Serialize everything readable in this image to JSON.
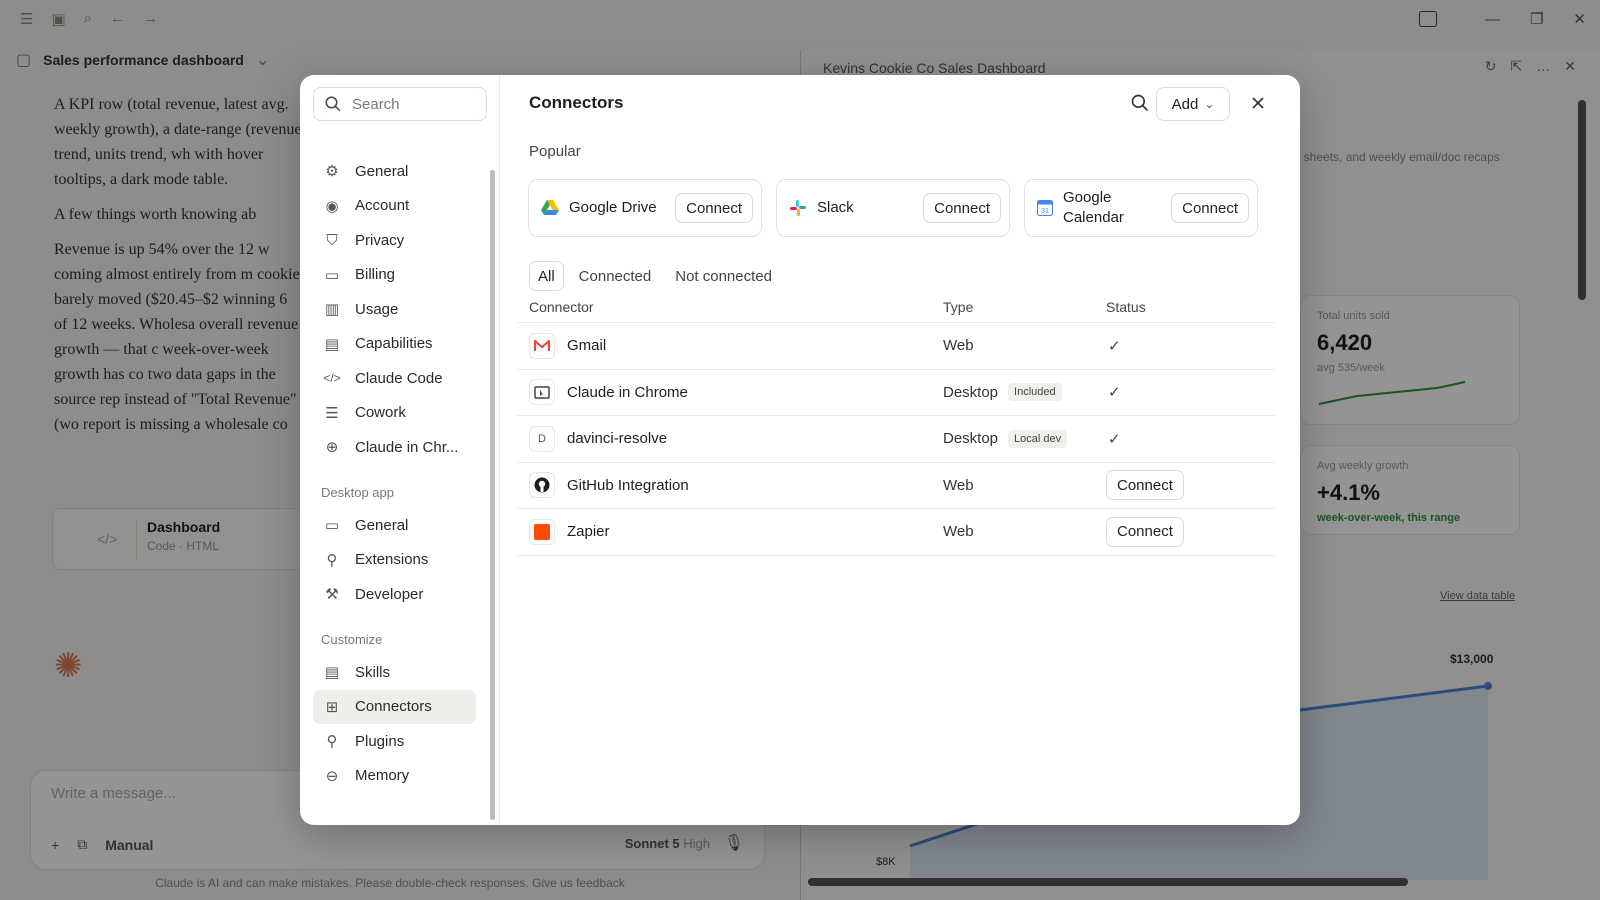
{
  "app": {
    "chat_title": "Sales performance dashboard",
    "chat_paragraphs": [
      "A KPI row (total revenue, latest avg. weekly growth), a date-range (revenue trend, units trend, wh with hover tooltips, a dark mode table.",
      "A few things worth knowing ab",
      "Revenue is up 54% over the 12 w coming almost entirely from m cookie barely moved ($20.45–$2 winning 6 of 12 weeks. Wholesa overall revenue growth — that c week-over-week growth has co two data gaps in the source rep instead of \"Total Revenue\" (wo report is missing a wholesale co"
    ],
    "artifact": {
      "title": "Dashboard",
      "subtitle": "Code · HTML"
    },
    "composer": {
      "placeholder": "Write a message...",
      "mode": "Manual",
      "model": "Sonnet 5",
      "effort": "High"
    },
    "disclaimer": "Claude is AI and can make mistakes. Please double-check responses. Give us feedback",
    "panel_title": "Kevins Cookie Co Sales Dashboard",
    "panel_snippet": "ops sheets, and weekly email/doc recaps",
    "kpis": [
      {
        "label": "Total units sold",
        "value": "6,420",
        "sub": "avg 535/week"
      },
      {
        "label": "Avg weekly growth",
        "value": "+4.1%",
        "sub": "week-over-week, this range"
      }
    ],
    "view_data_link": "View data table",
    "chart_peak": "$13,000",
    "chart_axis": "$8K"
  },
  "modal": {
    "search_placeholder": "Search",
    "nav_groups": [
      {
        "title": "",
        "items": [
          {
            "label": "General",
            "icon": "gear-icon"
          },
          {
            "label": "Account",
            "icon": "user-circle-icon"
          },
          {
            "label": "Privacy",
            "icon": "shield-icon"
          },
          {
            "label": "Billing",
            "icon": "card-icon"
          },
          {
            "label": "Usage",
            "icon": "bar-chart-icon"
          },
          {
            "label": "Capabilities",
            "icon": "briefcase-icon"
          },
          {
            "label": "Claude Code",
            "icon": "code-icon"
          },
          {
            "label": "Cowork",
            "icon": "list-icon"
          },
          {
            "label": "Claude in Chr...",
            "icon": "globe-icon"
          }
        ]
      },
      {
        "title": "Desktop app",
        "items": [
          {
            "label": "General",
            "icon": "monitor-icon"
          },
          {
            "label": "Extensions",
            "icon": "plug-icon"
          },
          {
            "label": "Developer",
            "icon": "wrench-icon"
          }
        ]
      },
      {
        "title": "Customize",
        "items": [
          {
            "label": "Skills",
            "icon": "scroll-icon"
          },
          {
            "label": "Connectors",
            "icon": "grid-plus-icon",
            "active": true
          },
          {
            "label": "Plugins",
            "icon": "plug-icon"
          },
          {
            "label": "Memory",
            "icon": "memory-icon"
          }
        ]
      }
    ],
    "title": "Connectors",
    "add_label": "Add",
    "popular_label": "Popular",
    "popular": [
      {
        "name": "Google Drive",
        "icon": "google-drive-icon",
        "action": "Connect"
      },
      {
        "name": "Slack",
        "icon": "slack-icon",
        "action": "Connect"
      },
      {
        "name": "Google Calendar",
        "icon": "google-calendar-icon",
        "action": "Connect"
      }
    ],
    "filters": [
      "All",
      "Connected",
      "Not connected"
    ],
    "columns": [
      "Connector",
      "Type",
      "Status"
    ],
    "rows": [
      {
        "name": "Gmail",
        "icon": "gmail-icon",
        "type": "Web",
        "badge": "",
        "status": "check"
      },
      {
        "name": "Claude in Chrome",
        "icon": "browser-icon",
        "type": "Desktop",
        "badge": "Included",
        "status": "check"
      },
      {
        "name": "davinci-resolve",
        "icon": "letter-d-icon",
        "type": "Desktop",
        "badge": "Local dev",
        "status": "check"
      },
      {
        "name": "GitHub Integration",
        "icon": "github-icon",
        "type": "Web",
        "badge": "",
        "status": "Connect"
      },
      {
        "name": "Zapier",
        "icon": "zapier-icon",
        "type": "Web",
        "badge": "",
        "status": "Connect"
      }
    ],
    "letter_d": "D",
    "check_glyph": "✓"
  },
  "colors": {
    "accent_orange": "#d97757",
    "overlay": "rgba(0,0,0,0.42)",
    "zapier": "#ff4a00",
    "green": "#2f8f3c",
    "chart_blue": "#4a86d6"
  }
}
